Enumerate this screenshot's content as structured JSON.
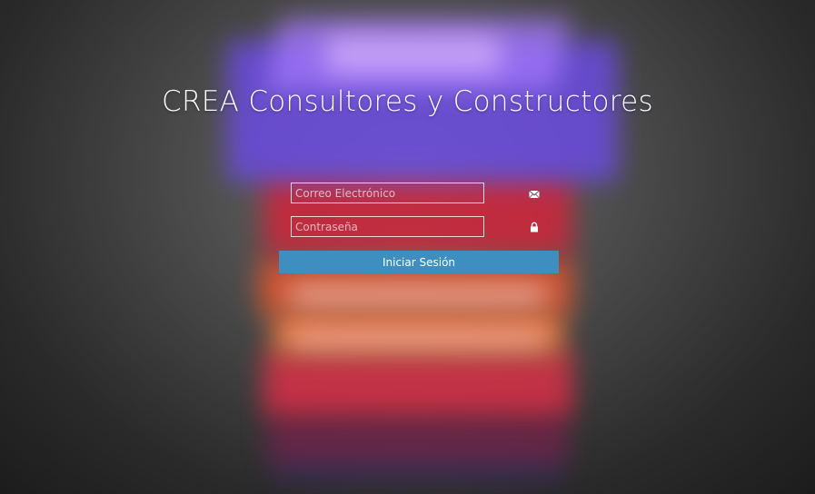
{
  "header": {
    "title": "CREA Consultores y Constructores"
  },
  "login": {
    "email_placeholder": "Correo Electrónico",
    "email_value": "",
    "password_placeholder": "Contraseña",
    "password_value": "",
    "email_icon": "envelope-icon",
    "password_icon": "lock-icon",
    "submit_label": "Iniciar Sesión"
  },
  "colors": {
    "button_bg": "#3e8fc0",
    "title_text": "#fbfbff",
    "field_border": "#ebebeb"
  }
}
